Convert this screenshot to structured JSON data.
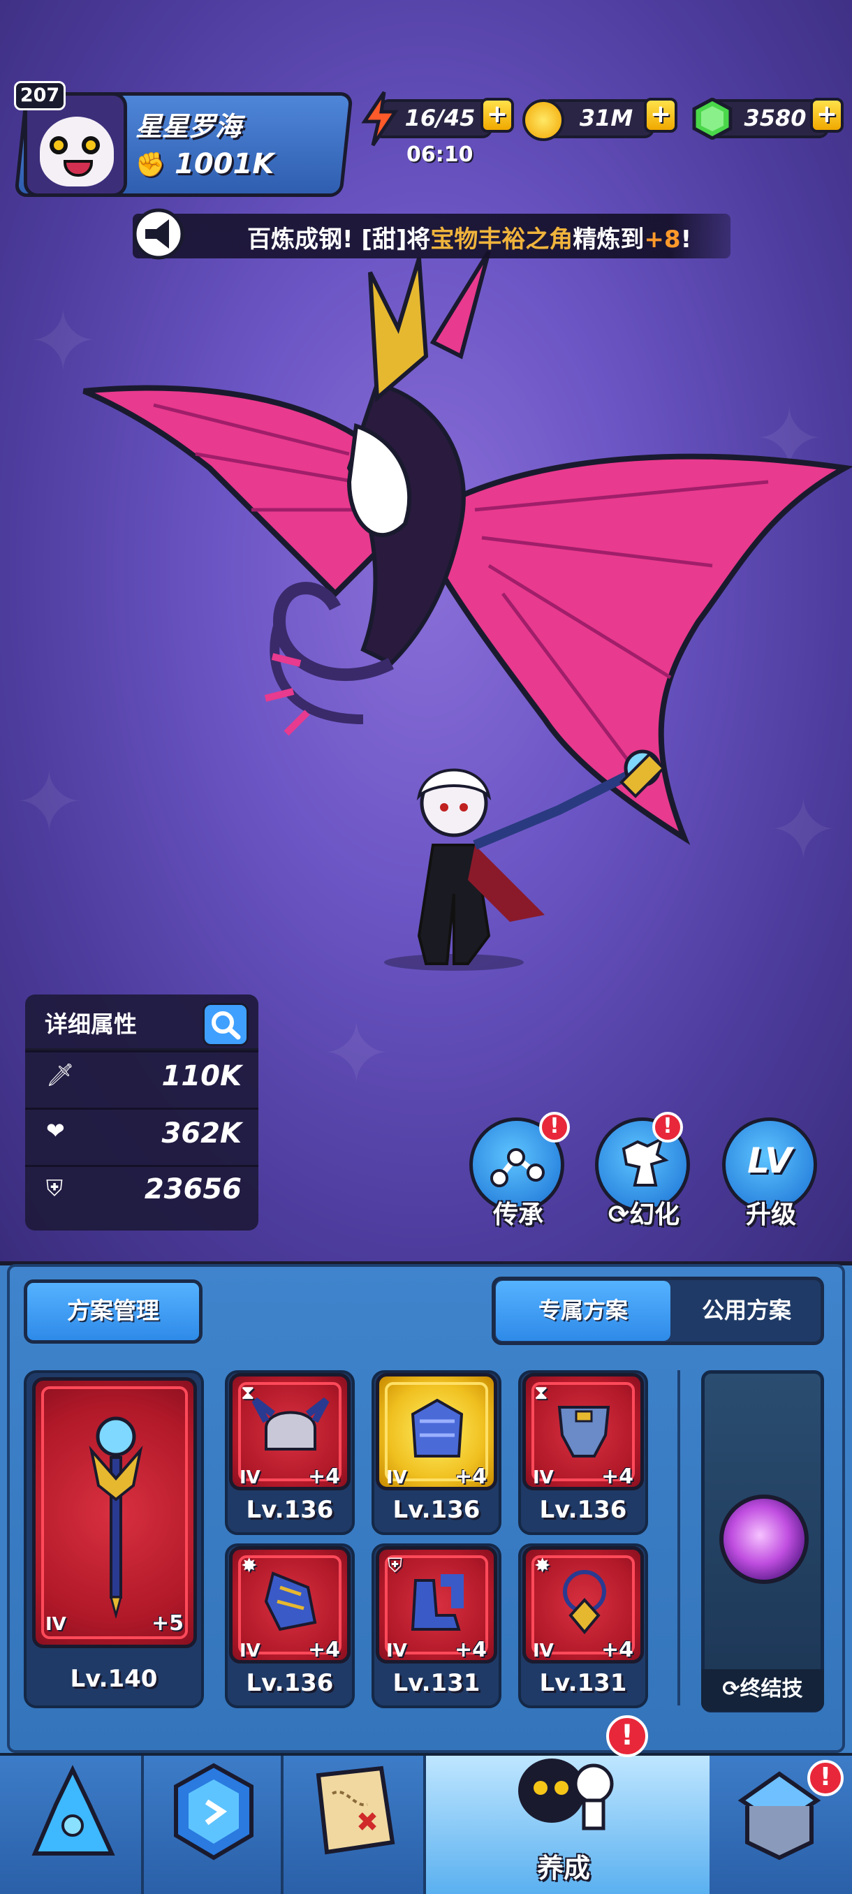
{
  "player": {
    "level": "207",
    "name": "星星罗海",
    "power": "1001K"
  },
  "resources": {
    "energy": "16/45",
    "energy_timer": "06:10",
    "coins": "31M",
    "gems": "3580",
    "plus_symbol": "+"
  },
  "announcement": {
    "prefix": "百炼成钢! [甜]将",
    "item": "宝物丰裕之角",
    "middle": "精炼到",
    "level": "+8",
    "suffix": "!"
  },
  "stats": {
    "title": "详细属性",
    "attack": "110K",
    "hp": "362K",
    "defense": "23656"
  },
  "actions": {
    "inherit": "传承",
    "transform": "幻化",
    "upgrade": "升级",
    "upgrade_icon_text": "LV"
  },
  "plan": {
    "manage_label": "方案管理",
    "tab_exclusive": "专属方案",
    "tab_public": "公用方案"
  },
  "weapon": {
    "tier": "IV",
    "plus": "+5",
    "level": "Lv.140"
  },
  "gear": [
    {
      "tier": "IV",
      "plus": "+4",
      "level": "Lv.136",
      "corner": "hourglass-icon",
      "gold": false
    },
    {
      "tier": "IV",
      "plus": "+4",
      "level": "Lv.136",
      "corner": "",
      "gold": true
    },
    {
      "tier": "IV",
      "plus": "+4",
      "level": "Lv.136",
      "corner": "hourglass-icon",
      "gold": false
    },
    {
      "tier": "IV",
      "plus": "+4",
      "level": "Lv.136",
      "corner": "burst-icon",
      "gold": false
    },
    {
      "tier": "IV",
      "plus": "+4",
      "level": "Lv.131",
      "corner": "shield-icon",
      "gold": false
    },
    {
      "tier": "IV",
      "plus": "+4",
      "level": "Lv.131",
      "corner": "burst-icon",
      "gold": false
    }
  ],
  "final_skill": {
    "label": "终结技"
  },
  "nav": {
    "active_label": "养成",
    "alert_mark": "!"
  },
  "colors": {
    "accent_blue": "#3fa0ff",
    "alert_red": "#e8283a",
    "highlight_gold": "#f0b43c"
  }
}
